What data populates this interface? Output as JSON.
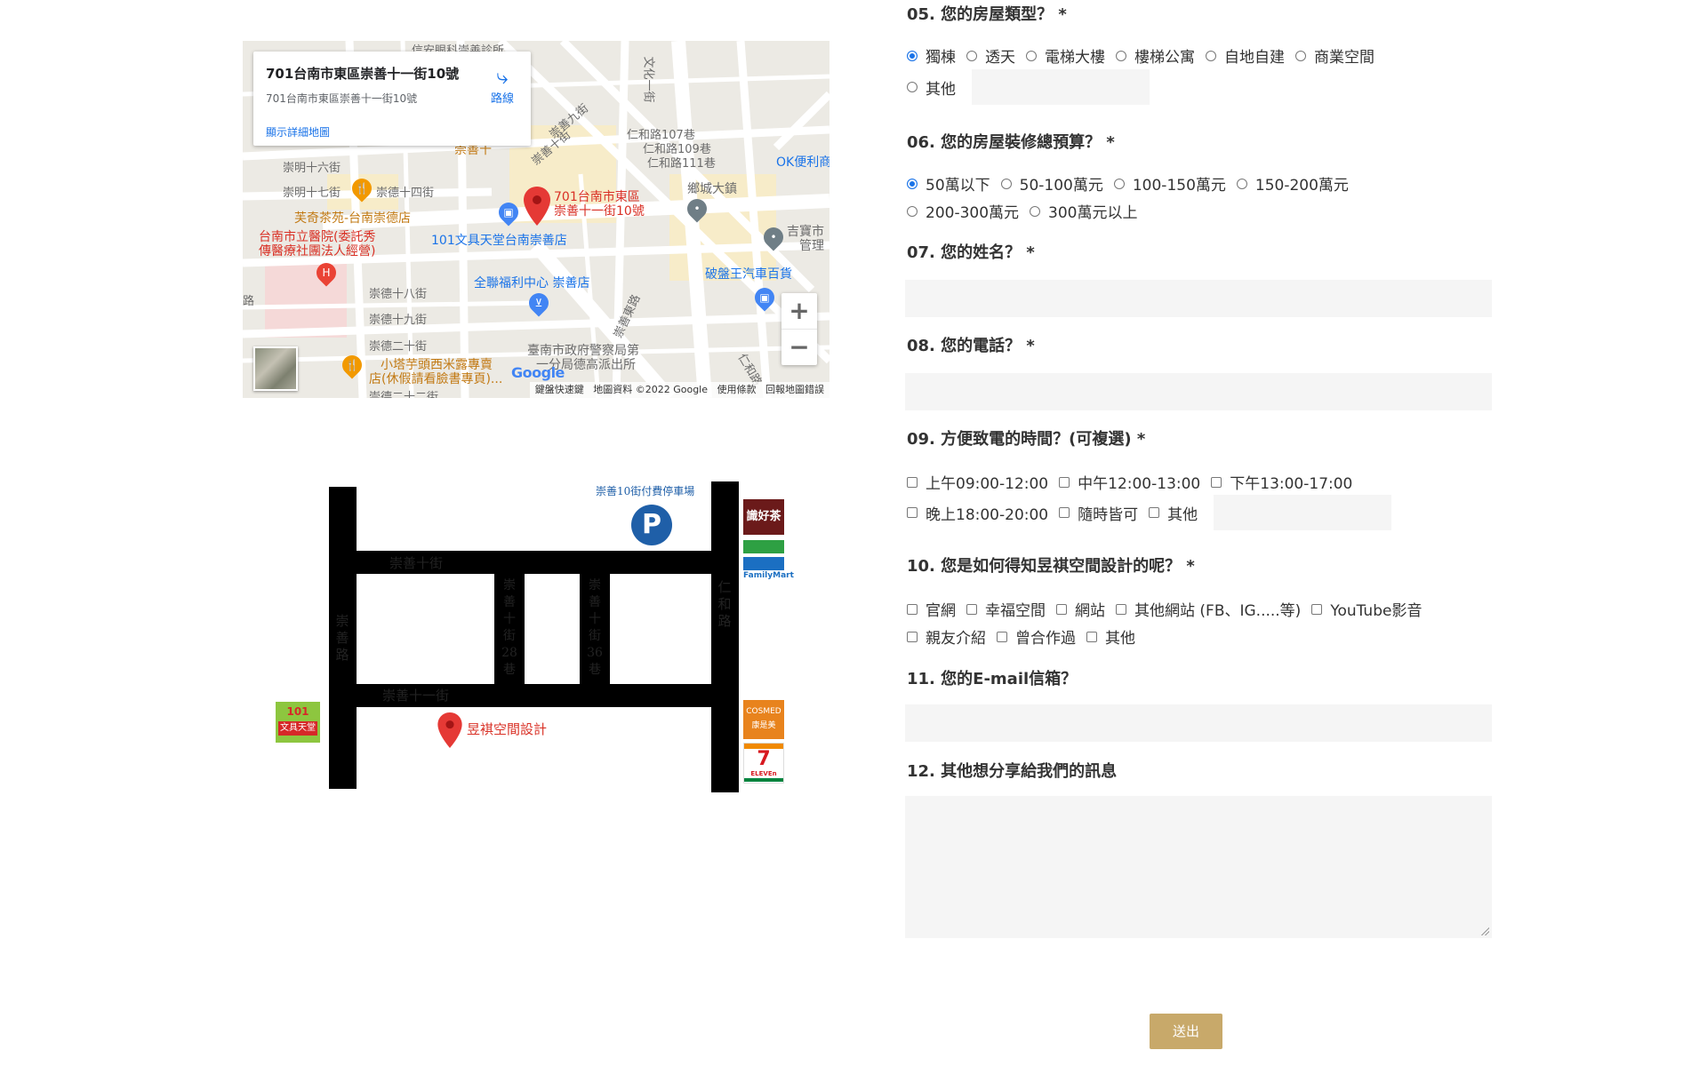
{
  "map": {
    "card_title": "701台南市東區崇善十一街10號",
    "card_address": "701台南市東區崇善十一街10號",
    "card_more_link": "顯示詳細地圖",
    "directions_label": "路線",
    "pin_label_line1": "701台南市東區",
    "pin_label_line2": "崇善十一街10號",
    "footer": {
      "keyboard": "鍵盤快速鍵",
      "data": "地圖資料 ©2022 Google",
      "terms": "使用條款",
      "report": "回報地圖錯誤"
    },
    "google_logo": "Google",
    "zoom_in": "+",
    "zoom_out": "−",
    "labels": {
      "top_clinic": "信安眼科崇善診所",
      "wenhua_road": "文化一街",
      "ren_he_107": "仁和路107巷",
      "ren_he_109": "仁和路109巷",
      "ren_he_111": "仁和路111巷",
      "ok_store": "OK便利商",
      "chongming16": "崇明十六街",
      "chongming17": "崇明十七街",
      "chongde14": "崇德十四街",
      "fuqi_tea": "芙奇茶苑-台南崇德店",
      "hospital_1": "台南市立醫院(委託秀",
      "hospital_2": "傳醫療社團法人經營)",
      "stationery": "101文具天堂台南崇善店",
      "pxmart": "全聯福利中心 崇善店",
      "chongde18": "崇德十八街",
      "chongde19": "崇德十九街",
      "chongde20": "崇德二十街",
      "chongde22": "崇德二十二街",
      "restaurant_1": "小塔芋頭西米露專賣",
      "restaurant_2": "店(休假請看臉書專頁)...",
      "police_1": "臺南市政府警察局第",
      "police_2": "一分局德高派出所",
      "xiangcheng": "鄉城大鎮",
      "jibao_1": "吉寶市",
      "jibao_2": "管理",
      "auto_parts": "破盤王汽車百貨",
      "chongshan9": "崇善九街",
      "chongshan10": "崇善十街",
      "chongshan_road": "崇善東路",
      "ren_he_road": "仁和路",
      "side_road": "路",
      "shop_10": "崇善十",
      "nine_block": "十八街"
    },
    "poi_icons": [
      "fork-knife-icon",
      "hospital-icon",
      "shopping-bag-icon",
      "cart-icon",
      "pin-icon"
    ]
  },
  "drawn_map": {
    "parking_label": "崇善10街付費停車場",
    "parking_symbol": "P",
    "road_chongshan10": "崇善十街",
    "road_chongshan11": "崇善十一街",
    "road_chongshan": [
      "崇",
      "善",
      "路"
    ],
    "road_renhe": [
      "仁",
      "和",
      "路"
    ],
    "lane_28": [
      "崇",
      "善",
      "十",
      "街",
      "28",
      "巷"
    ],
    "lane_36": [
      "崇",
      "善",
      "十",
      "街",
      "36",
      "巷"
    ],
    "destination": "昱褀空間設計",
    "stores": {
      "tea_shop": "識好茶",
      "familymart": "FamilyMart",
      "cosmed_en": "COSMED",
      "cosmed_zh": "康是美",
      "seven": "7",
      "seven_text": "ELEVEn",
      "stationery_num": "101",
      "stationery_name": "文具天堂"
    }
  },
  "form": {
    "q05": {
      "title": "05. 您的房屋類型？ *",
      "options": [
        "獨棟",
        "透天",
        "電梯大樓",
        "樓梯公寓",
        "自地自建",
        "商業空間",
        "其他"
      ],
      "selected": "獨棟"
    },
    "q06": {
      "title": "06. 您的房屋裝修總預算？ *",
      "options": [
        "50萬以下",
        "50-100萬元",
        "100-150萬元",
        "150-200萬元",
        "200-300萬元",
        "300萬元以上"
      ],
      "selected": "50萬以下"
    },
    "q07": {
      "title": "07. 您的姓名？ *"
    },
    "q08": {
      "title": "08. 您的電話？ *"
    },
    "q09": {
      "title": "09. 方便致電的時間？(可複選) *",
      "options": [
        "上午09:00-12:00",
        "中午12:00-13:00",
        "下午13:00-17:00",
        "晚上18:00-20:00",
        "隨時皆可",
        "其他"
      ]
    },
    "q10": {
      "title": "10. 您是如何得知昱褀空間設計的呢？ *",
      "options": [
        "官網",
        "幸福空間",
        "網站",
        "其他網站 (FB、IG.....等)",
        "YouTube影音",
        "親友介紹",
        "曾合作過",
        "其他"
      ]
    },
    "q11": {
      "title": "11. 您的E-mail信箱？"
    },
    "q12": {
      "title": "12. 其他想分享給我們的訊息"
    },
    "submit_label": "送出"
  },
  "colors": {
    "accent": "#c8a96a",
    "radio_checked": "#1a73e8",
    "field_bg": "#f5f5f5",
    "map_red": "#d93025",
    "map_blue": "#1a73e8",
    "map_brown": "#c27a14"
  }
}
